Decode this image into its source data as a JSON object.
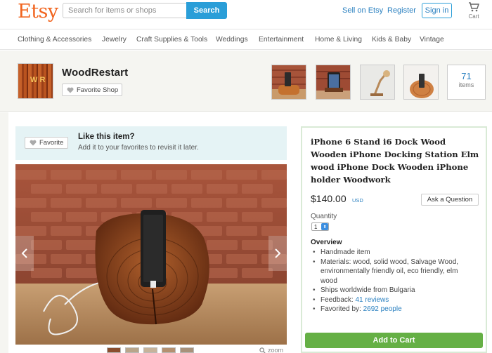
{
  "header": {
    "logo": "Etsy",
    "search_placeholder": "Search for items or shops",
    "search_button": "Search",
    "sell_link": "Sell on Etsy",
    "register_link": "Register",
    "signin_button": "Sign in",
    "cart_label": "Cart"
  },
  "categories": [
    "Clothing & Accessories",
    "Jewelry",
    "Craft Supplies & Tools",
    "Weddings",
    "Entertainment",
    "Home & Living",
    "Kids & Baby",
    "Vintage"
  ],
  "shop": {
    "name": "WoodRestart",
    "favorite_button": "Favorite Shop",
    "items_count": "71",
    "items_label": "items"
  },
  "like_panel": {
    "favorite_button": "Favorite",
    "title": "Like this item?",
    "subtitle": "Add it to your favorites to revisit it later."
  },
  "gallery": {
    "zoom_label": "zoom"
  },
  "listing": {
    "title": "iPhone 6 Stand i6 Dock Wood Wooden iPhone Docking Station Elm wood iPhone Dock Wooden iPhone holder Woodwork",
    "price": "$140.00",
    "currency": "USD",
    "ask_button": "Ask a Question",
    "quantity_label": "Quantity",
    "quantity_value": "1",
    "overview_title": "Overview",
    "overview": {
      "handmade": "Handmade item",
      "materials": "Materials: wood, solid wood, Salvage Wood, environmentally friendly oil, eco friendly, elm wood",
      "ships": "Ships worldwide from Bulgaria",
      "feedback_label": "Feedback:",
      "feedback_link": "41 reviews",
      "favorited_label": "Favorited by:",
      "favorited_link": "2692 people"
    },
    "add_to_cart": "Add to Cart"
  },
  "colors": {
    "brand": "#f1641e",
    "link": "#2a80c0",
    "search": "#2a9ed8",
    "cart_button": "#65b045",
    "like_panel_bg": "#e5f3f5"
  }
}
